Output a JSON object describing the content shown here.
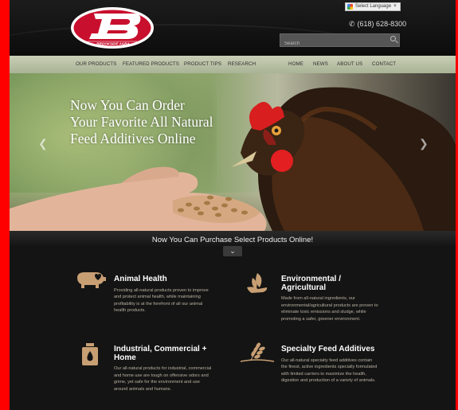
{
  "header": {
    "logo_text": "BROOKSIDE AGRA",
    "phone": "(618) 628-8300",
    "language_label": "Select Language",
    "search_placeholder": "Search"
  },
  "nav": {
    "items": [
      {
        "label": "OUR PRODUCTS"
      },
      {
        "label": "FEATURED PRODUCTS"
      },
      {
        "label": "PRODUCT TIPS"
      },
      {
        "label": "RESEARCH"
      },
      {
        "label": "HOME"
      },
      {
        "label": "NEWS"
      },
      {
        "label": "ABOUT US"
      },
      {
        "label": "CONTACT"
      }
    ]
  },
  "hero": {
    "headline": "Now You Can Order Your Favorite All Natural Feed Additives Online",
    "tagline": "Now You Can Purchase Select Products Online!"
  },
  "features": [
    {
      "title": "Animal Health",
      "icon": "pig-heart-icon",
      "text": "Providing all-natural products proven to improve and protect animal health, while maintaining profitability is at the forefront of all our animal health products."
    },
    {
      "title": "Environmental / Agricultural",
      "icon": "leaf-hand-icon",
      "text": "Made from all-natural ingredients, our environmental/agricultural products are proven to eliminate toxic emissions and sludge, while promoting a safer, greener environment."
    },
    {
      "title": "Industrial, Commercial + Home",
      "icon": "bottle-drop-icon",
      "text": "Our all-natural products for industrial, commercial and home use are tough on offensive odors and grime, yet safe for the environment and use around animals and humans."
    },
    {
      "title": "Specialty Feed Additives",
      "icon": "wheat-icon",
      "text": "Our all-natural specialty feed additives contain the finest, active ingredients specially formulated with limited carriers to maximize the health, digestion and production of a variety of animals."
    }
  ],
  "colors": {
    "accent": "#c8102e",
    "nav_bg": "#b9c2a5",
    "body_bg": "#141414",
    "icon_tan": "#c89f73"
  }
}
